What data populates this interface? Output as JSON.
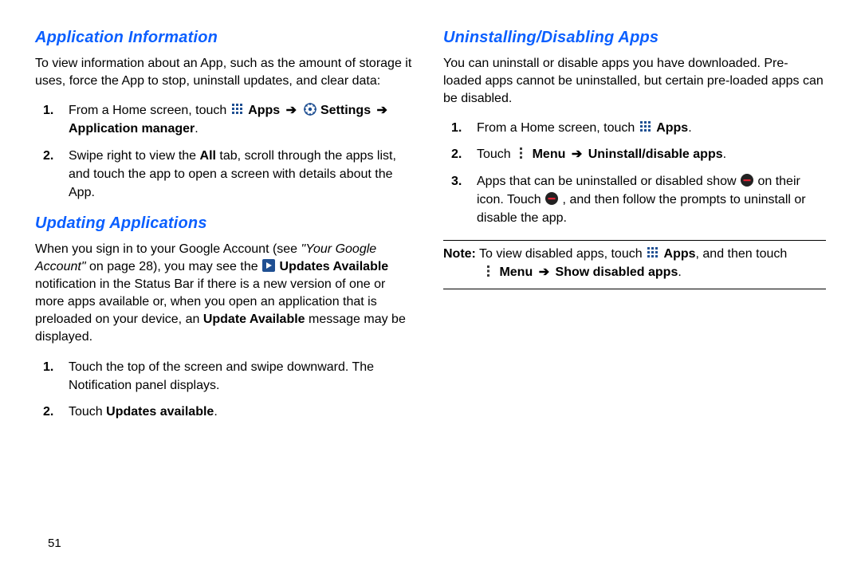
{
  "page_number": "51",
  "left": {
    "section1": {
      "heading": "Application Information",
      "intro": "To view information about an App, such as the amount of storage it uses, force the App to stop, uninstall updates, and clear data:",
      "step1_a": "From a Home screen, touch ",
      "step1_b": "Apps",
      "step1_c": "Settings",
      "step1_d": "Application manager",
      "step2_a": "Swipe right to view the ",
      "step2_b": "All",
      "step2_c": " tab, scroll through the apps list, and touch the app to open a screen with details about the App."
    },
    "section2": {
      "heading": "Updating Applications",
      "para_a": "When you sign in to your Google Account (see ",
      "para_ref": "\"Your Google Account\"",
      "para_b": " on page 28), you may see the ",
      "para_c": "Updates Available",
      "para_d": " notification in the Status Bar if there is a new version of one or more apps available or, when you open an application that is preloaded on your device, an ",
      "para_e": "Update Available",
      "para_f": " message may be displayed.",
      "step1": "Touch the top of the screen and swipe downward. The Notification panel displays.",
      "step2_a": "Touch ",
      "step2_b": "Updates available",
      "step2_c": "."
    }
  },
  "right": {
    "section1": {
      "heading": "Uninstalling/Disabling Apps",
      "intro": "You can uninstall or disable apps you have downloaded. Pre-loaded apps cannot be uninstalled, but certain pre-loaded apps can be disabled.",
      "step1_a": "From a Home screen, touch ",
      "step1_b": "Apps",
      "step1_c": ".",
      "step2_a": "Touch ",
      "step2_b": "Menu",
      "step2_c": "Uninstall/disable apps",
      "step2_d": ".",
      "step3_a": "Apps that can be uninstalled or disabled show ",
      "step3_b": " on their icon. Touch ",
      "step3_c": ", and then follow the prompts to uninstall or disable the app."
    },
    "note": {
      "label": "Note:",
      "a": " To view disabled apps, touch ",
      "b": "Apps",
      "c": ", and then touch ",
      "d": "Menu",
      "e": "Show disabled apps",
      "f": "."
    }
  },
  "icons": {
    "apps": "apps-grid-icon",
    "settings": "settings-gear-icon",
    "menu": "menu-dots-icon",
    "updates": "updates-play-icon",
    "remove": "remove-circle-icon"
  }
}
